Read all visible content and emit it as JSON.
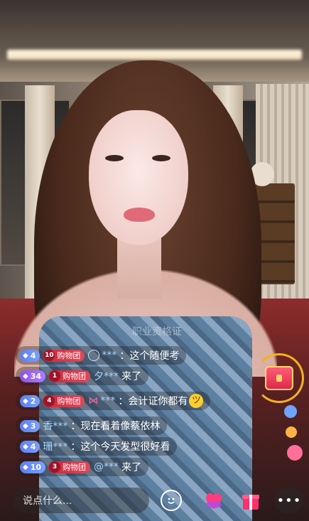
{
  "stream": {
    "chat_faded": "职业资格证",
    "messages": [
      {
        "level": "4",
        "level_style": "blue",
        "fan_level": "10",
        "fan_label": "购物团",
        "user": "***",
        "prefix_icon": "circle",
        "text": "这个随便考"
      },
      {
        "level": "34",
        "level_style": "purple",
        "fan_level": "1",
        "fan_label": "购物团",
        "user": "夕***",
        "text": "来了"
      },
      {
        "level": "2",
        "level_style": "blue",
        "fan_level": "4",
        "fan_label": "购物团",
        "user": "***",
        "prefix_icon": "bow",
        "text": "会计证你都有",
        "emoji": "laughing-tears"
      },
      {
        "level": "3",
        "level_style": "blue",
        "user": "香***",
        "text": "现在看着像蔡依林"
      },
      {
        "level": "4",
        "level_style": "blue",
        "user": "珊***",
        "text": "这个今天发型很好看"
      },
      {
        "level": "10",
        "level_style": "blue",
        "fan_level": "3",
        "fan_label": "购物团",
        "user": "@***",
        "text": "来了"
      }
    ],
    "separator": "：",
    "colors": {
      "level_blue": "#6a8cf5",
      "level_purple": "#9a66f2",
      "fan_red": "#d53a4c",
      "treasure_ring": "#f4b21d"
    }
  },
  "bottom_bar": {
    "input_placeholder": "说点什么...",
    "more_label": "•••",
    "icons": [
      "emoji-icon",
      "heart-gift-icon",
      "gift-box-icon",
      "more-icon"
    ]
  }
}
